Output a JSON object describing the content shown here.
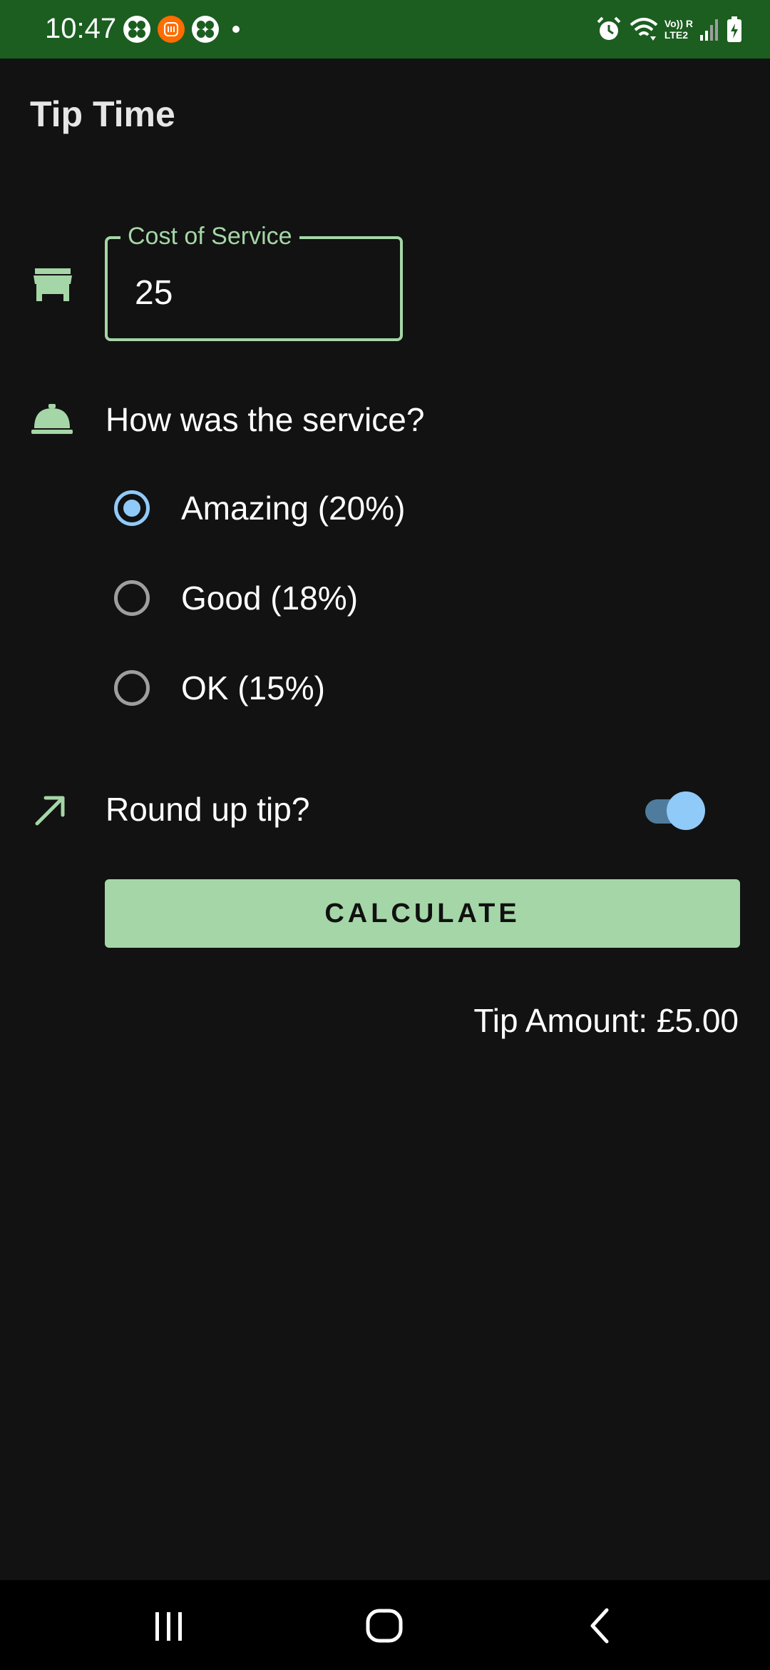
{
  "status_bar": {
    "time": "10:47",
    "network_top": "Vo)) R",
    "network_bottom": "LTE2",
    "color": "#1b5e20"
  },
  "app": {
    "title": "Tip Time"
  },
  "cost_field": {
    "label": "Cost of Service",
    "value": "25",
    "icon": "store-icon"
  },
  "service": {
    "question": "How was the service?",
    "icon": "room-service-bell-icon",
    "options": [
      {
        "label": "Amazing (20%)",
        "selected": true
      },
      {
        "label": "Good (18%)",
        "selected": false
      },
      {
        "label": "OK (15%)",
        "selected": false
      }
    ]
  },
  "round_up": {
    "label": "Round up tip?",
    "enabled": true,
    "icon": "trending-up-arrow-icon"
  },
  "calculate": {
    "label": "CALCULATE"
  },
  "result": {
    "text": "Tip Amount: £5.00"
  },
  "colors": {
    "accent_green": "#a5d6a7",
    "accent_blue": "#90caf9",
    "background": "#121212"
  },
  "nav": {
    "recents_icon": "recents-icon",
    "home_icon": "home-icon",
    "back_icon": "back-icon"
  }
}
